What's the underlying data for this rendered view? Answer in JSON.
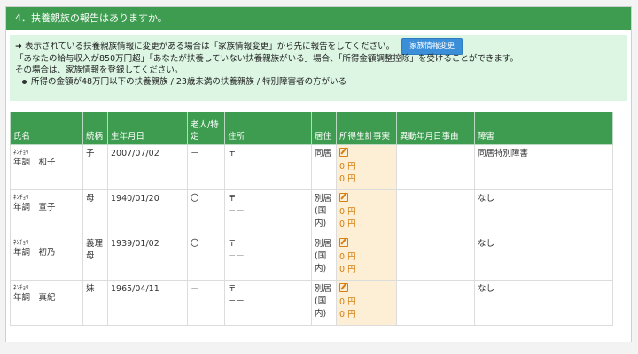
{
  "section": {
    "title": "4．扶養親族の報告はありますか。"
  },
  "info": {
    "line1": "表示されている扶養親族情報に変更がある場合は「家族情報変更」から先に報告をしてください。",
    "button": "家族情報変更",
    "line2": "「あなたの給与収入が850万円超」「あなたが扶養していない扶養親族がいる」場合、「所得金額調整控除」を受けることができます。",
    "line3": "その場合は、家族情報を登録してください。",
    "line4": "所得の金額が48万円以下の扶養親族 / 23歳未満の扶養親族 / 特別障害者の方がいる"
  },
  "table": {
    "headers": [
      "氏名",
      "続柄",
      "生年月日",
      "老人/特定",
      "住所",
      "居住",
      "所得生計事実",
      "異動年月日事由",
      "障害"
    ],
    "rows": [
      {
        "kana": "ﾈﾝﾁｮｳ",
        "name": "年調　和子",
        "rel": "子",
        "dob": "2007/07/02",
        "elder": "－",
        "addr1": "〒",
        "addr2": "－－",
        "res": "同居",
        "income1": "0 円",
        "income2": "0 円",
        "change": "",
        "dis": "同居特別障害"
      },
      {
        "kana": "ﾈﾝﾁｮｳ",
        "name": "年調　宣子",
        "rel": "母",
        "dob": "1940/01/20",
        "elder": "〇",
        "addr1": "〒",
        "addr2": "－－",
        "res": "別居(国内)",
        "income1": "0 円",
        "income2": "0 円",
        "change": "",
        "dis": "なし"
      },
      {
        "kana": "ﾈﾝﾁｮｳ",
        "name": "年調　初乃",
        "rel": "義理母",
        "dob": "1939/01/02",
        "elder": "〇",
        "addr1": "〒",
        "addr2": "－－",
        "res": "別居(国内)",
        "income1": "0 円",
        "income2": "0 円",
        "change": "",
        "dis": "なし"
      },
      {
        "kana": "ﾈﾝﾁｮｳ",
        "name": "年調　真紀",
        "rel": "妹",
        "dob": "1965/04/11",
        "elder": "－",
        "addr1": "〒",
        "addr2": "－－",
        "res": "別居(国内)",
        "income1": "0 円",
        "income2": "0 円",
        "change": "",
        "dis": "なし"
      }
    ]
  },
  "colors": {
    "header_green": "#3d9c4f",
    "info_bg": "#dcf6e3",
    "income_bg": "#fdeed6",
    "button_blue": "#3b8fd9"
  }
}
